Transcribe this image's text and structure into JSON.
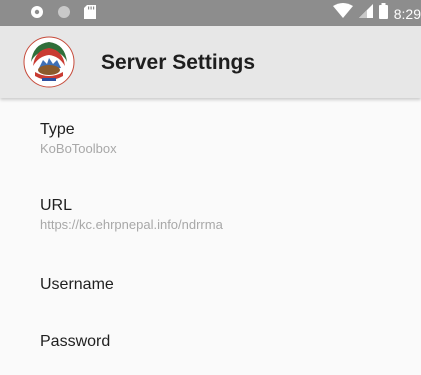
{
  "status_bar": {
    "time": "8:29",
    "icons": [
      "settings-gear-icon",
      "circle-icon",
      "sd-card-icon",
      "wifi-icon",
      "signal-icon",
      "battery-icon"
    ]
  },
  "app_bar": {
    "title": "Server Settings",
    "logo_icon": "emblem-logo-icon"
  },
  "preferences": [
    {
      "title": "Type",
      "summary": "KoBoToolbox"
    },
    {
      "title": "URL",
      "summary": "https://kc.ehrpnepal.info/ndrrma"
    },
    {
      "title": "Username",
      "summary": ""
    },
    {
      "title": "Password",
      "summary": ""
    }
  ],
  "colors": {
    "status_bar_bg": "#8d8d8d",
    "app_bar_bg": "#e7e7e7",
    "background": "#fafafa",
    "title_text": "#1f1f1f",
    "summary_text": "#a8a8a8"
  }
}
